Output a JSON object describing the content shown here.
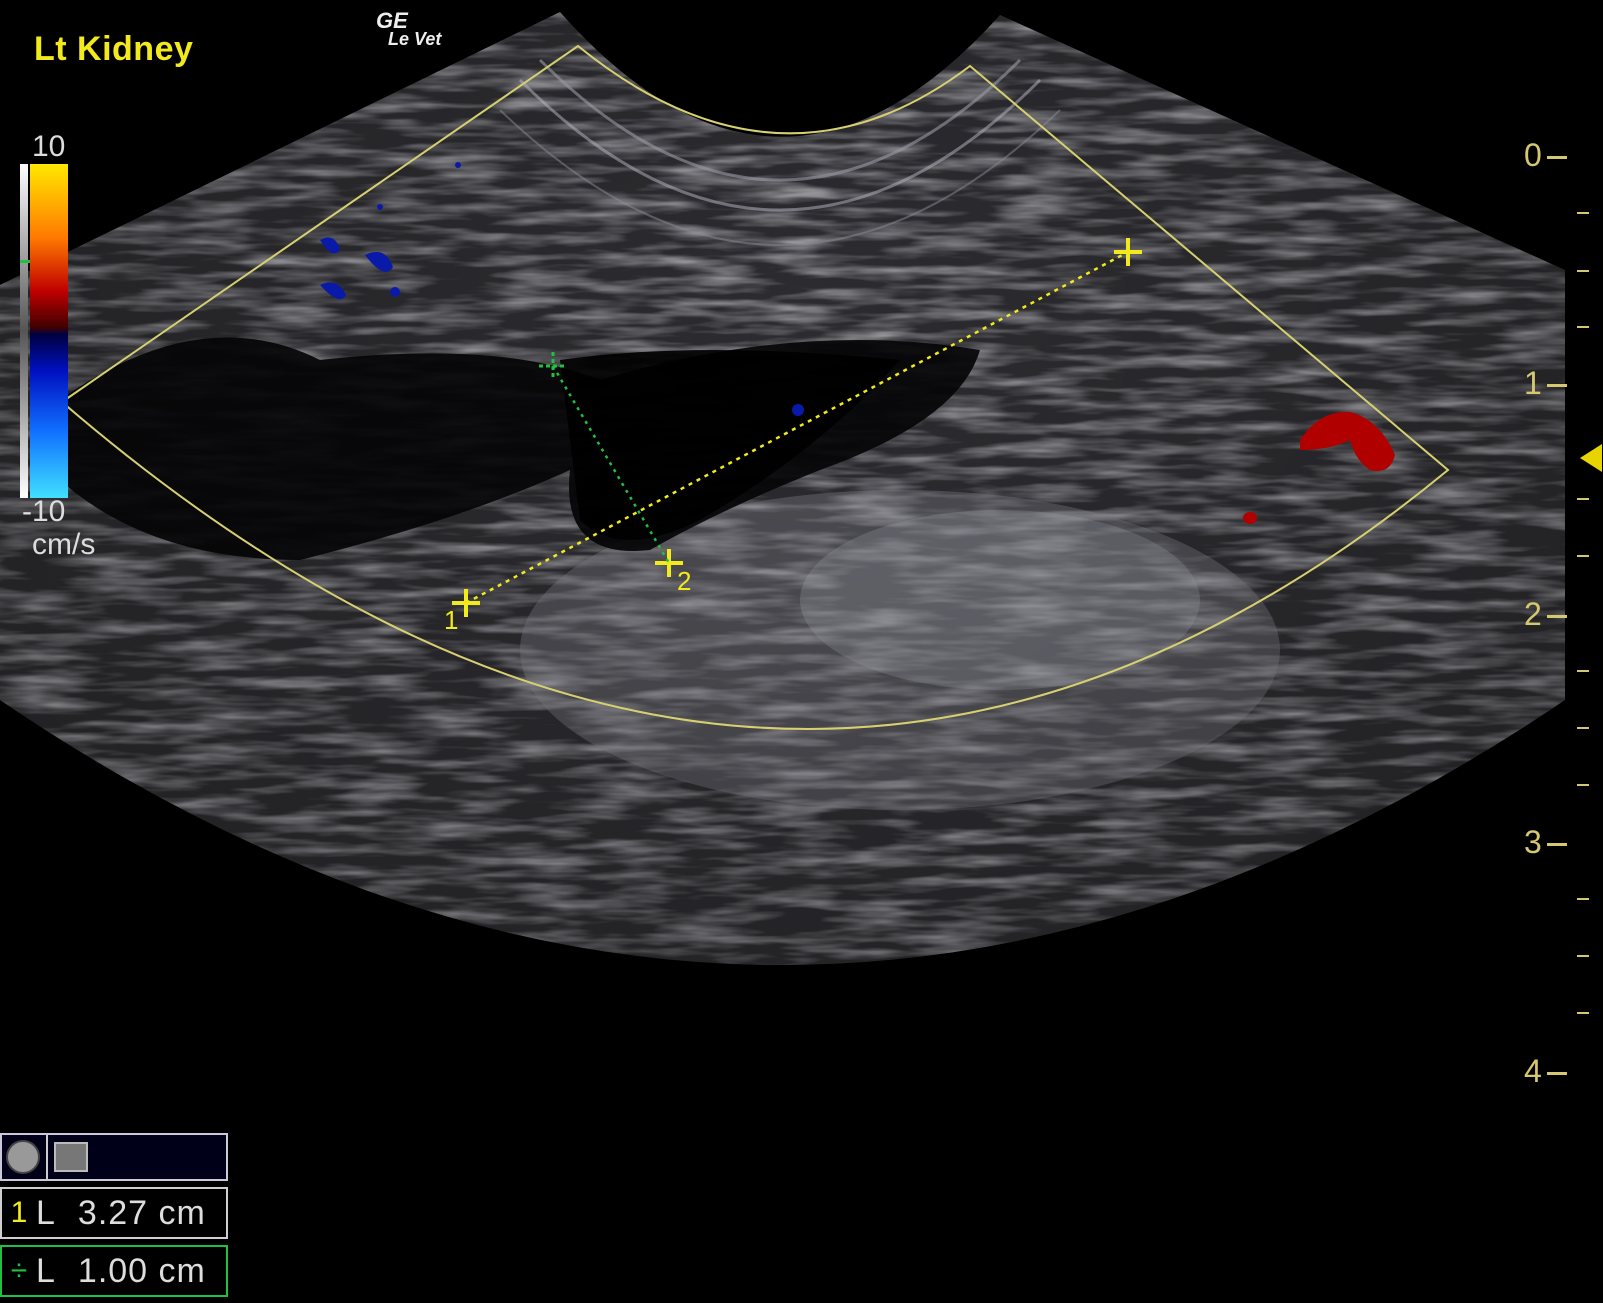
{
  "title": "Lt Kidney",
  "brand": {
    "line1": "GE",
    "line2": "Le Vet"
  },
  "colorbar": {
    "max": "10",
    "min": "-10",
    "unit": "cm/s"
  },
  "depth_scale": [
    "0",
    "1",
    "2",
    "3",
    "4"
  ],
  "caliper_labels": {
    "first": "1",
    "second": "2"
  },
  "measurements": [
    {
      "index": "1",
      "label": "L",
      "value": "3.27 cm",
      "color": "#f2ea1c"
    },
    {
      "index": "÷",
      "label": "L",
      "value": "1.00 cm",
      "color": "#20c040"
    }
  ],
  "colors": {
    "caliper_yellow": "#f2ea1c",
    "caliper_green": "#20c040",
    "doppler_red": "#b00000",
    "doppler_blue": "#0a1aa8"
  }
}
